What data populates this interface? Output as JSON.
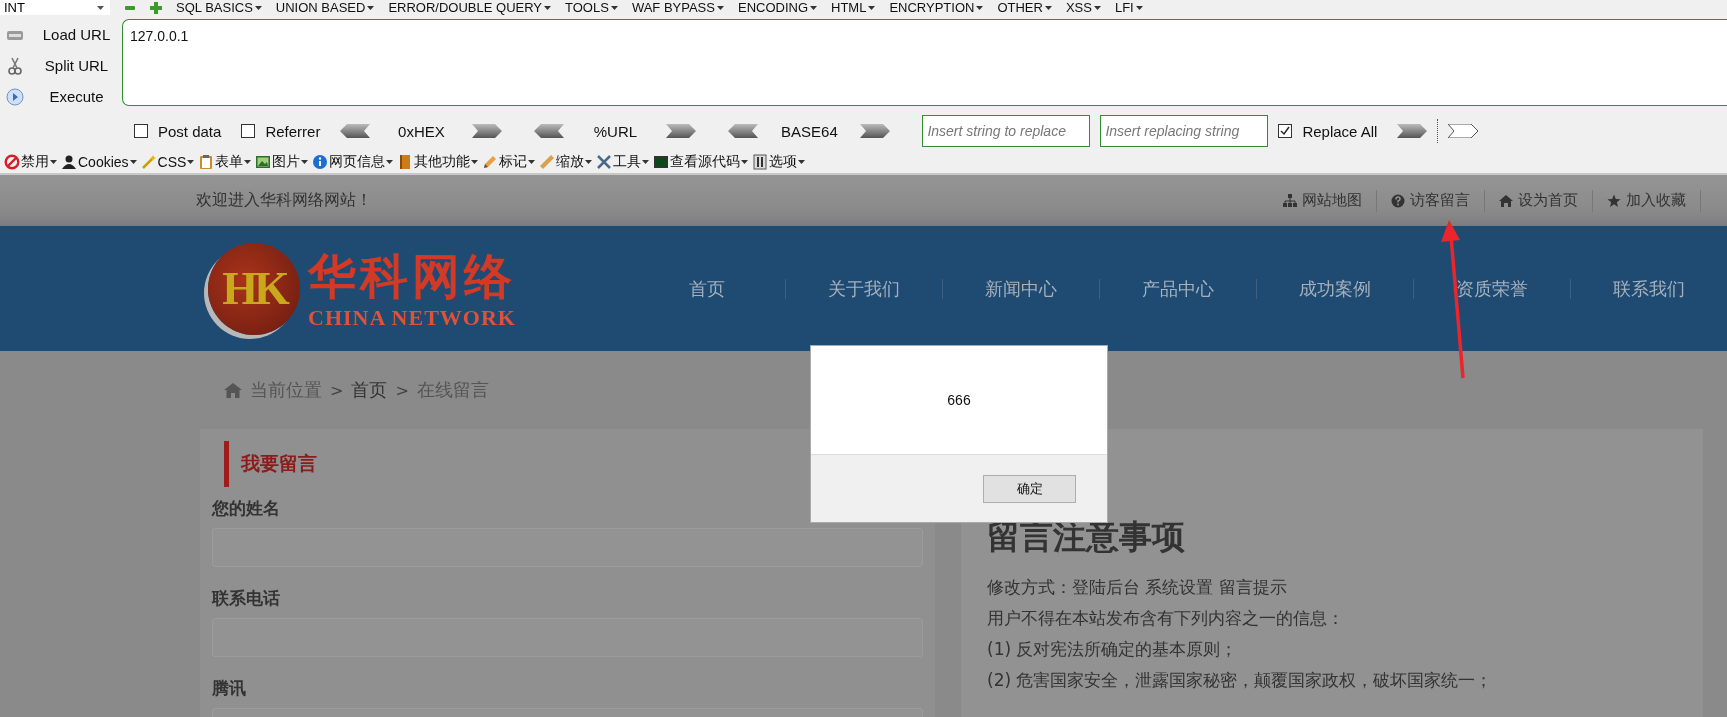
{
  "hackbar": {
    "mode": "INT",
    "menus": [
      "SQL BASICS",
      "UNION BASED",
      "ERROR/DOUBLE QUERY",
      "TOOLS",
      "WAF BYPASS",
      "ENCODING",
      "HTML",
      "ENCRYPTION",
      "OTHER",
      "XSS",
      "LFI"
    ],
    "actions": [
      "Load URL",
      "Split URL",
      "Execute"
    ],
    "url": "127.0.0.1",
    "options": [
      {
        "label": "Post data",
        "checked": false
      },
      {
        "label": "Referrer",
        "checked": false
      }
    ],
    "encoders": [
      "0xHEX",
      "%URL",
      "BASE64"
    ],
    "replace_from": {
      "placeholder": "Insert string to replace"
    },
    "replace_to": {
      "placeholder": "Insert replacing string"
    },
    "replace_all": {
      "label": "Replace All",
      "checked": true
    }
  },
  "browser_toolbar": [
    "禁用",
    "Cookies",
    "CSS",
    "表单",
    "图片",
    "网页信息",
    "其他功能",
    "标记",
    "缩放",
    "工具",
    "查看源代码",
    "选项"
  ],
  "site": {
    "welcome": "欢迎进入华科网络网站！",
    "top_links": [
      "网站地图",
      "访客留言",
      "设为首页",
      "加入收藏"
    ],
    "logo": {
      "mark": "HK",
      "name": "华科网络",
      "subtitle": "CHINA NETWORK"
    },
    "nav": [
      "首页",
      "关于我们",
      "新闻中心",
      "产品中心",
      "成功案例",
      "资质荣誉",
      "联系我们"
    ],
    "breadcrumb": [
      {
        "text": "当前位置",
        "kind": "label"
      },
      {
        "text": ">",
        "kind": "separator"
      },
      {
        "text": "首页",
        "kind": "link"
      },
      {
        "text": ">",
        "kind": "separator"
      },
      {
        "text": "在线留言",
        "kind": "current"
      }
    ],
    "form": {
      "title": "我要留言",
      "fields": [
        "您的姓名",
        "联系电话",
        "腾讯"
      ]
    },
    "notice": {
      "title": "留言注意事项",
      "lines": [
        "修改方式：登陆后台  系统设置 留言提示",
        "用户不得在本站发布含有下列内容之一的信息：",
        "(1) 反对宪法所确定的基本原则；",
        "(2) 危害国家安全，泄露国家秘密，颠覆国家政权，破坏国家统一；"
      ]
    }
  },
  "dialog": {
    "message": "666",
    "button": "确定"
  }
}
